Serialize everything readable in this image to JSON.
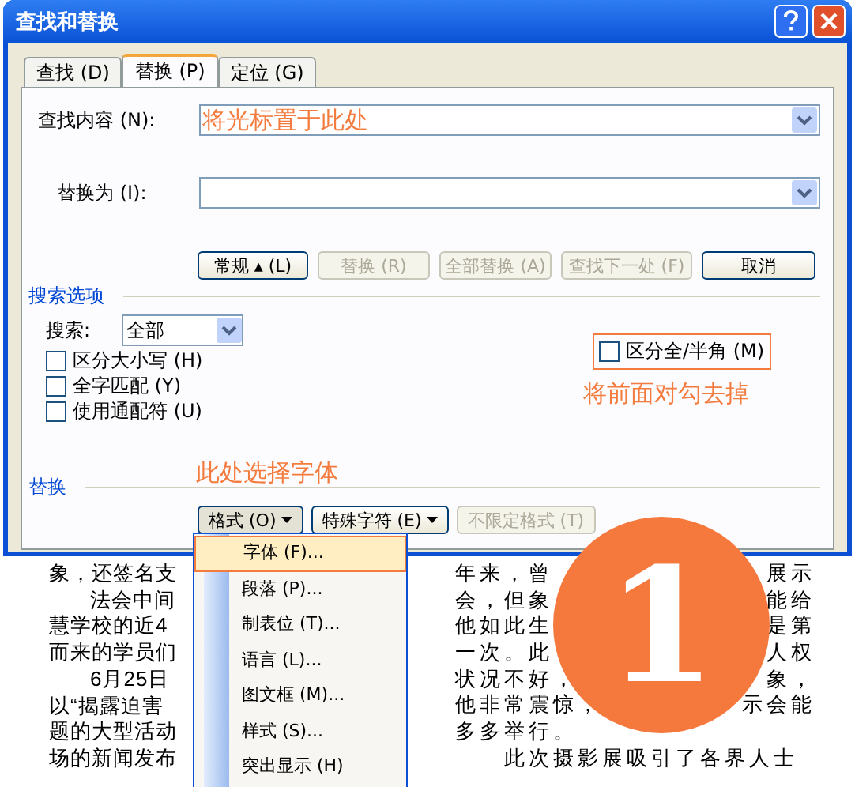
{
  "window": {
    "title": "查找和替换"
  },
  "tabs": [
    {
      "label": "查找 (D)",
      "selected": false
    },
    {
      "label": "替换 (P)",
      "selected": true
    },
    {
      "label": "定位 (G)",
      "selected": false
    }
  ],
  "find": {
    "label": "查找内容 (N):",
    "value": "将光标置于此处"
  },
  "replace": {
    "label": "替换为 (I):"
  },
  "buttons": [
    {
      "label": "常规 ▴ (L)",
      "disabled": false
    },
    {
      "label": "替换 (R)",
      "disabled": true
    },
    {
      "label": "全部替换 (A)",
      "disabled": true
    },
    {
      "label": "查找下一处 (F)",
      "disabled": true
    },
    {
      "label": "取消",
      "disabled": false
    }
  ],
  "search_options": {
    "heading": "搜索选项",
    "search_label": "搜索:",
    "search_scope": "全部",
    "checkboxes": [
      {
        "label": "区分大小写 (H)",
        "checked": false
      },
      {
        "label": "全字匹配 (Y)",
        "checked": false
      },
      {
        "label": "使用通配符 (U)",
        "checked": false
      }
    ],
    "width_checkbox": {
      "label": "区分全/半角 (M)",
      "checked": false
    }
  },
  "replace_section": {
    "heading": "替换",
    "buttons": [
      {
        "label": "格式 (O)",
        "dropdown": true,
        "disabled": false
      },
      {
        "label": "特殊字符 (E)",
        "dropdown": true,
        "disabled": false
      },
      {
        "label": "不限定格式 (T)",
        "dropdown": false,
        "disabled": true
      }
    ]
  },
  "format_menu": [
    {
      "label": "字体 (F)...",
      "selected": true
    },
    {
      "label": "段落 (P)...",
      "selected": false
    },
    {
      "label": "制表位 (T)...",
      "selected": false
    },
    {
      "label": "语言 (L)...",
      "selected": false
    },
    {
      "label": "图文框 (M)...",
      "selected": false
    },
    {
      "label": "样式 (S)...",
      "selected": false
    },
    {
      "label": "突出显示 (H)",
      "selected": false
    }
  ],
  "annotations": {
    "checkbox_note": "将前面对勾去掉",
    "format_note": "此处选择字体",
    "step": "1"
  },
  "document": {
    "left_lines": [
      {
        "text": "象，还签名支",
        "indent": false
      },
      {
        "text": "法会中间",
        "indent": true
      },
      {
        "text": "慧学校的近4",
        "indent": false
      },
      {
        "text": "而来的学员们",
        "indent": false
      },
      {
        "text": "6月25日",
        "indent": true
      },
      {
        "text": "以“揭露迫害",
        "indent": false
      },
      {
        "text": "题的大型活动",
        "indent": false
      },
      {
        "text": "场的新闻发布",
        "indent": false
      }
    ],
    "right_lines": [
      {
        "start": "年来，曾",
        "end": "展示"
      },
      {
        "start": "会，但象",
        "end": "能给"
      },
      {
        "start": "他如此生",
        "end": "是第"
      },
      {
        "start": "一次。此",
        "end": "人权"
      },
      {
        "start": "状况不好，",
        "end": "象，"
      },
      {
        "start": "他非常震惊，",
        "end": "示会能"
      },
      {
        "start": "多多举行。"
      },
      {
        "start": "　　此次摄影展吸引了各界人士"
      }
    ]
  }
}
